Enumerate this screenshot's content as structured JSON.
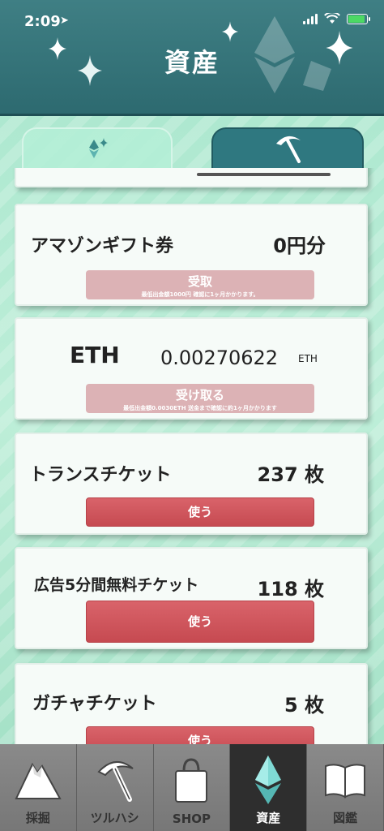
{
  "status": {
    "time": "2:09"
  },
  "header": {
    "title": "資産"
  },
  "cards": {
    "amazon": {
      "label": "アマゾンギフト券",
      "value": "0円分",
      "button": "受取",
      "note": "最低出金額1000円 確認に1ヶ月かかります。"
    },
    "eth": {
      "label": "ETH",
      "value": "0.00270622",
      "unit": "ETH",
      "button": "受け取る",
      "note": "最低出金額0.0030ETH 送金まで確認に約1ヶ月かかります"
    },
    "trance": {
      "label": "トランスチケット",
      "value": "237 枚",
      "button": "使う"
    },
    "ad": {
      "label": "広告5分間無料チケット",
      "value": "118 枚",
      "button": "使う"
    },
    "gacha": {
      "label": "ガチャチケット",
      "value": "5 枚",
      "button": "使う"
    }
  },
  "nav": [
    {
      "label": "採掘",
      "icon": "mountain-icon"
    },
    {
      "label": "ツルハシ",
      "icon": "pickaxe-icon"
    },
    {
      "label": "SHOP",
      "icon": "shopping-bag-icon"
    },
    {
      "label": "資産",
      "icon": "ethereum-icon"
    },
    {
      "label": "図鑑",
      "icon": "book-icon"
    }
  ],
  "colors": {
    "header": "#2d6a70",
    "accent_red": "#c64a51",
    "disabled_pink": "#dcb2b5",
    "background": "#a8e6cd"
  }
}
